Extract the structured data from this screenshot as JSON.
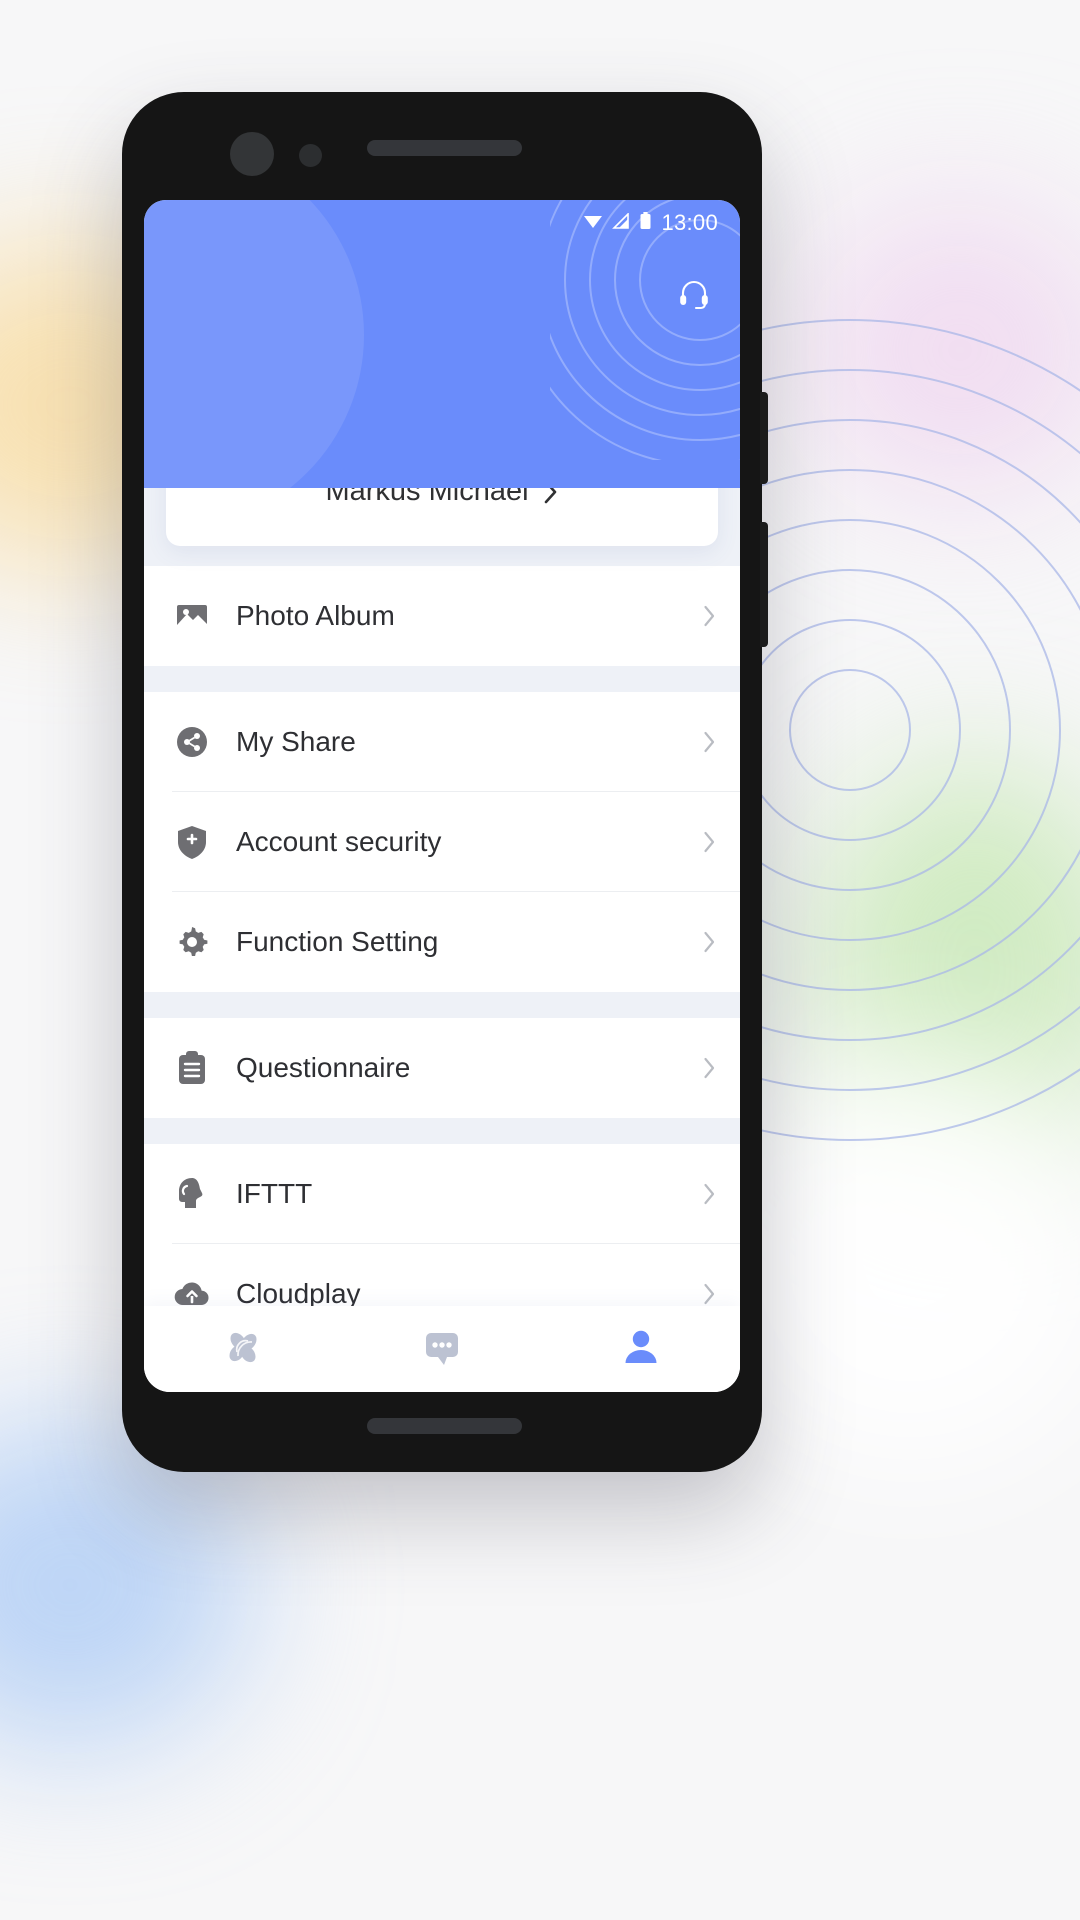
{
  "device": {
    "frame": "android-phone-mockup"
  },
  "status_bar": {
    "time": "13:00",
    "icons": [
      "wifi-icon",
      "signal-icon",
      "battery-icon"
    ]
  },
  "header": {
    "background_color": "#6a8cfb",
    "support_button": {
      "icon": "headset-icon",
      "label": "Customer Support"
    },
    "avatar": {
      "icon": "robot-avatar-icon"
    }
  },
  "profile": {
    "name": "Markus Michael",
    "chevron": "chevron-right-icon"
  },
  "menu_groups": [
    {
      "items": [
        {
          "label": "Photo Album",
          "icon": "photo-album-icon"
        }
      ]
    },
    {
      "items": [
        {
          "label": "My Share",
          "icon": "share-icon"
        },
        {
          "label": "Account security",
          "icon": "shield-plus-icon"
        },
        {
          "label": "Function Setting",
          "icon": "gear-icon"
        }
      ]
    },
    {
      "items": [
        {
          "label": "Questionnaire",
          "icon": "clipboard-icon"
        }
      ]
    },
    {
      "items": [
        {
          "label": "IFTTT",
          "icon": "head-profile-icon"
        },
        {
          "label": "Cloudplay",
          "icon": "cloud-upload-icon"
        }
      ]
    }
  ],
  "bottom_nav": {
    "items": [
      {
        "name": "devices",
        "icon": "pinwheel-icon",
        "active": false
      },
      {
        "name": "messages",
        "icon": "chat-bubble-icon",
        "active": false
      },
      {
        "name": "profile",
        "icon": "person-icon",
        "active": true
      }
    ],
    "active_color": "#6a8cfb",
    "inactive_color": "#bcc2d2"
  }
}
